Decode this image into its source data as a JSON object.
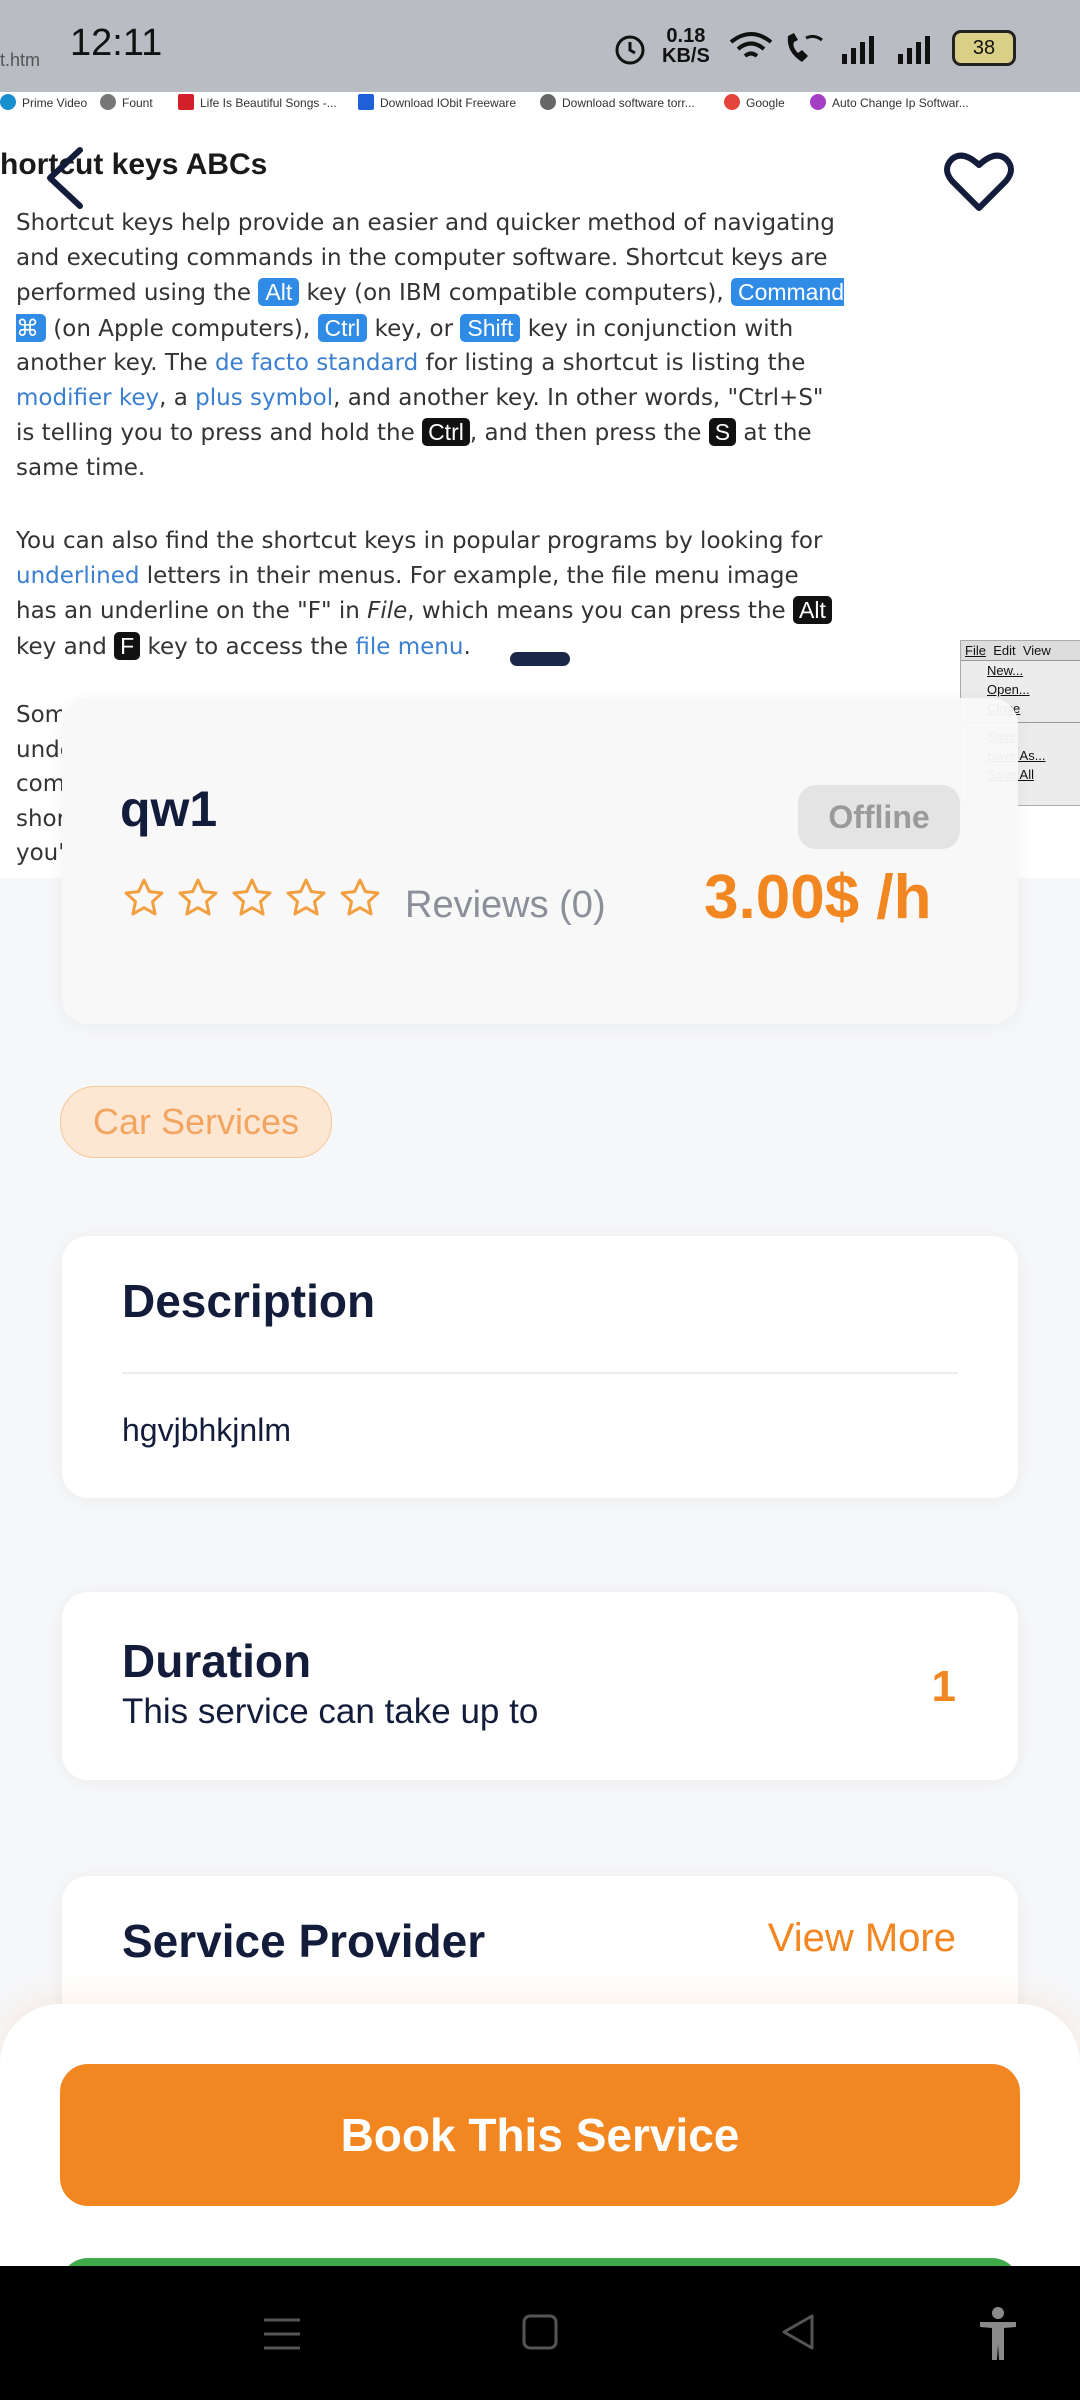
{
  "status_bar": {
    "time": "12:11",
    "speed_value": "0.18",
    "speed_unit": "KB/S",
    "battery": "38"
  },
  "browser": {
    "url_fragment": "t.htm",
    "bookmarks": [
      "Prime Video",
      "Fount",
      "Life Is Beautiful Songs -...",
      "Download IObit Freeware",
      "Download software torr...",
      "Google",
      "Auto Change Ip Softwar..."
    ]
  },
  "article": {
    "title": "hortcut keys ABCs",
    "file_menu": {
      "menu_bar": [
        "File",
        "Edit",
        "View"
      ],
      "items": [
        "New...",
        "Open...",
        "Close",
        "Save",
        "Save As...",
        "Save All"
      ]
    }
  },
  "service": {
    "name": "qw1",
    "status": "Offline",
    "reviews": "Reviews (0)",
    "price": "3.00$ /h",
    "rating": 0,
    "category": "Car Services",
    "description_title": "Description",
    "description": "hgvjbhkjnlm",
    "duration_title": "Duration",
    "duration_subtitle": "This service can take up to",
    "duration_value": "1",
    "provider_title": "Service Provider",
    "view_more": "View More",
    "book_button": "Book This Service"
  },
  "colors": {
    "accent": "#F28722",
    "navy": "#131D3B",
    "green": "#3FAA4C"
  }
}
